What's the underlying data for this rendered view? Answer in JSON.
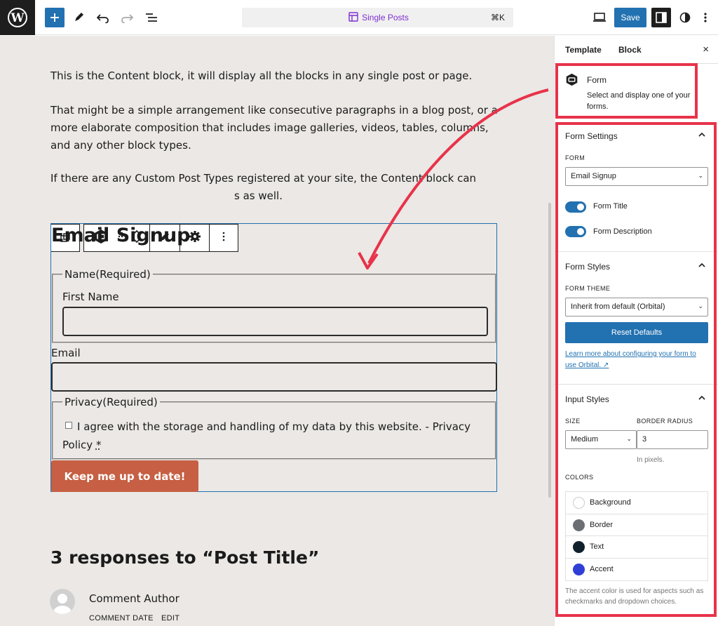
{
  "topbar": {
    "title": "Single Posts",
    "shortcut": "⌘K",
    "save_label": "Save"
  },
  "content": {
    "p1": "This is the Content block, it will display all the blocks in any single post or page.",
    "p2": "That might be a simple arrangement like consecutive paragraphs in a blog post, or a more elaborate composition that includes image galleries, videos, tables, columns, and any other block types.",
    "p3_a": "If there are any Custom Post Types registered at your site, the Content block can",
    "p3_b": "s as well."
  },
  "form": {
    "title": "Email Signup",
    "name_legend": "Name(Required)",
    "first_name_label": "First Name",
    "email_label": "Email",
    "privacy_legend": "Privacy(Required)",
    "privacy_text": "I agree with the storage and handling of my data by this website. - Privacy Policy",
    "privacy_asterisk": "*",
    "submit_label": "Keep me up to date!"
  },
  "comments": {
    "heading": "3 responses to “Post Title”",
    "author": "Comment Author",
    "date": "COMMENT DATE",
    "edit": "EDIT"
  },
  "sidebar": {
    "tab_template": "Template",
    "tab_block": "Block",
    "close": "×",
    "block_title": "Form",
    "block_desc": "Select and display one of your forms.",
    "form_settings": {
      "title": "Form Settings",
      "form_caption": "FORM",
      "form_value": "Email Signup",
      "toggle_title": "Form Title",
      "toggle_desc": "Form Description"
    },
    "form_styles": {
      "title": "Form Styles",
      "theme_caption": "FORM THEME",
      "theme_value": "Inherit from default (Orbital)",
      "reset_label": "Reset Defaults",
      "learn_more": "Learn more about configuring your form to use Orbital. ↗"
    },
    "input_styles": {
      "title": "Input Styles",
      "size_caption": "SIZE",
      "size_value": "Medium",
      "radius_caption": "BORDER RADIUS",
      "radius_value": "3",
      "radius_help": "In pixels.",
      "colors_caption": "COLORS",
      "colors": [
        {
          "label": "Background",
          "color": "#ffffff"
        },
        {
          "label": "Border",
          "color": "#6b6e72"
        },
        {
          "label": "Text",
          "color": "#12202e"
        },
        {
          "label": "Accent",
          "color": "#2f3fd6"
        }
      ],
      "accent_help": "The accent color is used for aspects such as checkmarks and dropdown choices."
    }
  },
  "colors": {
    "wp_blue": "#2271b1",
    "annotation_red": "#e8334a",
    "submit_bg": "#c65f43",
    "canvas_bg": "#ebe8e5"
  }
}
